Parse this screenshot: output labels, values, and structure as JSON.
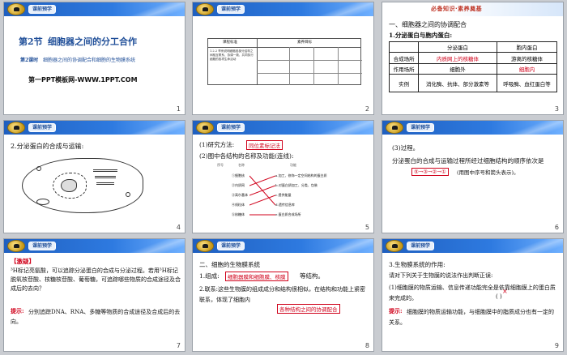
{
  "brand_tag": "课前预学",
  "slides": [
    {
      "page": "1",
      "section": "第2节",
      "title": "细胞器之间的分工合作",
      "subtitle_lesson": "第2课时",
      "subtitle": "细胞器之间的协调配合和细胞的生物膜系统",
      "template_note": "第一PPT模板网-WWW.1PPT.COM"
    },
    {
      "page": "2",
      "table_headers": [
        "课程标准",
        "素养目标"
      ],
      "body": "1.2.2 举例说明细胞各部分结构之间相互联系、协调一致，共同执行细胞的各项生命活动"
    },
    {
      "page": "3",
      "stamp": "必备知识·素养奠基",
      "heading": "一、细胞器之间的协调配合",
      "sub": "1.分泌蛋白与胞内蛋白:",
      "table": {
        "col1": [
          "",
          "合成场所",
          "作用场所",
          "实例"
        ],
        "col2": [
          "分泌蛋白",
          "",
          "细胞外",
          "消化酶、抗体、部分激素等"
        ],
        "col3": [
          "胞内蛋白",
          "游离的核糖体",
          "",
          "呼吸酶、血红蛋白等"
        ]
      },
      "answers": [
        "内质网上的核糖体",
        "细胞内"
      ]
    },
    {
      "page": "4",
      "heading": "2.分泌蛋白的合成与运输:"
    },
    {
      "page": "5",
      "line1_prefix": "(1)研究方法:",
      "line1_answer": "同位素标记法",
      "line2": "(2)图中各结构的名称及功能(连线):",
      "left_labels": [
        "①细胞核",
        "②内质网",
        "③高尔基体",
        "④线粒体",
        "⑤核糖体"
      ],
      "right_labels": [
        "a.加工、修饰一定空间结构的蛋白质",
        "b.对蛋白质加工、分类、包装",
        "c.提供能量",
        "d.遗传信息库",
        "e.蛋白质合成场所"
      ],
      "col_heads": [
        "序号",
        "名称",
        "功能"
      ]
    },
    {
      "page": "6",
      "line1": "(3)过程。",
      "line2": "分泌蛋白的合成与运输过程所经过细胞结构的顺序依次是",
      "answer": "⑤→③→②→①",
      "line2_suffix": "(用图中序号和箭头表示)。"
    },
    {
      "page": "7",
      "tag": "【激疑】",
      "body": "³H标记亮氨酸，可以追踪分泌蛋白的合成与分泌过程。若用³H标记脱氧核苷酸、核糖核苷酸、葡萄糖，可追踪哪些物质的合成途径及合成后的去向？",
      "hint_label": "提示:",
      "hint": "分别追踪DNA、RNA、多糖等物质的合成途径及合成后的去向。"
    },
    {
      "page": "8",
      "heading": "二、细胞的生物膜系统",
      "line1_prefix": "1.组成:",
      "line1_answer": "细胞器膜和细胞膜、核膜",
      "line1_suffix": "等结构。",
      "line2": "2.联系:这些生物膜的组成成分和结构很相似，在结构和功能上紧密联系，体现了细胞内",
      "answer2": "各种结构之间的协调配合"
    },
    {
      "page": "9",
      "heading": "3.生物膜系统的作用:",
      "line1": "请对下列关于生物膜的说法作出判断正误:",
      "statement": "(1)细胞膜的物质运输、信息传递功能完全是依靠细胞膜上的蛋白质来完成的。",
      "paren": "(   )",
      "mark": "×",
      "hint_label": "提示:",
      "hint": "细胞膜的物质运输功能，与细胞膜中的脂质成分也有一定的关系。"
    }
  ]
}
